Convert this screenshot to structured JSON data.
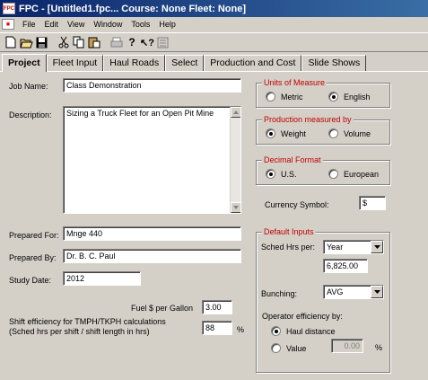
{
  "window": {
    "title": "FPC - [Untitled1.fpc...   Course: None    Fleet: None]",
    "icon_text": "FPC"
  },
  "menu": [
    "File",
    "Edit",
    "View",
    "Window",
    "Tools",
    "Help"
  ],
  "toolbar_icons": [
    "new-icon",
    "open-icon",
    "save-icon",
    "cut-icon",
    "copy-icon",
    "paste-icon",
    "print-icon",
    "help-icon",
    "context-help-icon",
    "properties-icon"
  ],
  "tabs": [
    "Project",
    "Fleet Input",
    "Haul Roads",
    "Select",
    "Production and Cost",
    "Slide Shows"
  ],
  "form": {
    "job_name_label": "Job Name:",
    "job_name": "Class Demonstration",
    "description_label": "Description:",
    "description": "Sizing a Truck Fleet for an Open Pit Mine",
    "prepared_for_label": "Prepared For:",
    "prepared_for": "Mnge 440",
    "prepared_by_label": "Prepared By:",
    "prepared_by": "Dr. B. C. Paul",
    "study_date_label": "Study Date:",
    "study_date": "2012",
    "fuel_label": "Fuel $ per Gallon",
    "fuel": "3.00",
    "shift_eff_label_1": "Shift efficiency for TMPH/TKPH calculations",
    "shift_eff_label_2": "(Sched hrs per shift / shift length in hrs)",
    "shift_eff": "88",
    "shift_eff_unit": "%"
  },
  "units": {
    "title": "Units of Measure",
    "metric": "Metric",
    "english": "English",
    "selected": "English"
  },
  "production": {
    "title": "Production measured by",
    "weight": "Weight",
    "volume": "Volume",
    "selected": "Weight"
  },
  "decimal": {
    "title": "Decimal Format",
    "us": "U.S.",
    "european": "European",
    "selected": "U.S."
  },
  "currency": {
    "label": "Currency Symbol:",
    "value": "$"
  },
  "defaults": {
    "title": "Default Inputs",
    "sched_label": "Sched Hrs per:",
    "sched_value": "Year",
    "sched_hours": "6,825.00",
    "bunching_label": "Bunching:",
    "bunching_value": "AVG",
    "op_eff_label": "Operator efficiency by:",
    "haul_distance": "Haul distance",
    "value_label": "Value",
    "value": "0.00",
    "value_unit": "%",
    "selected": "Haul distance"
  }
}
